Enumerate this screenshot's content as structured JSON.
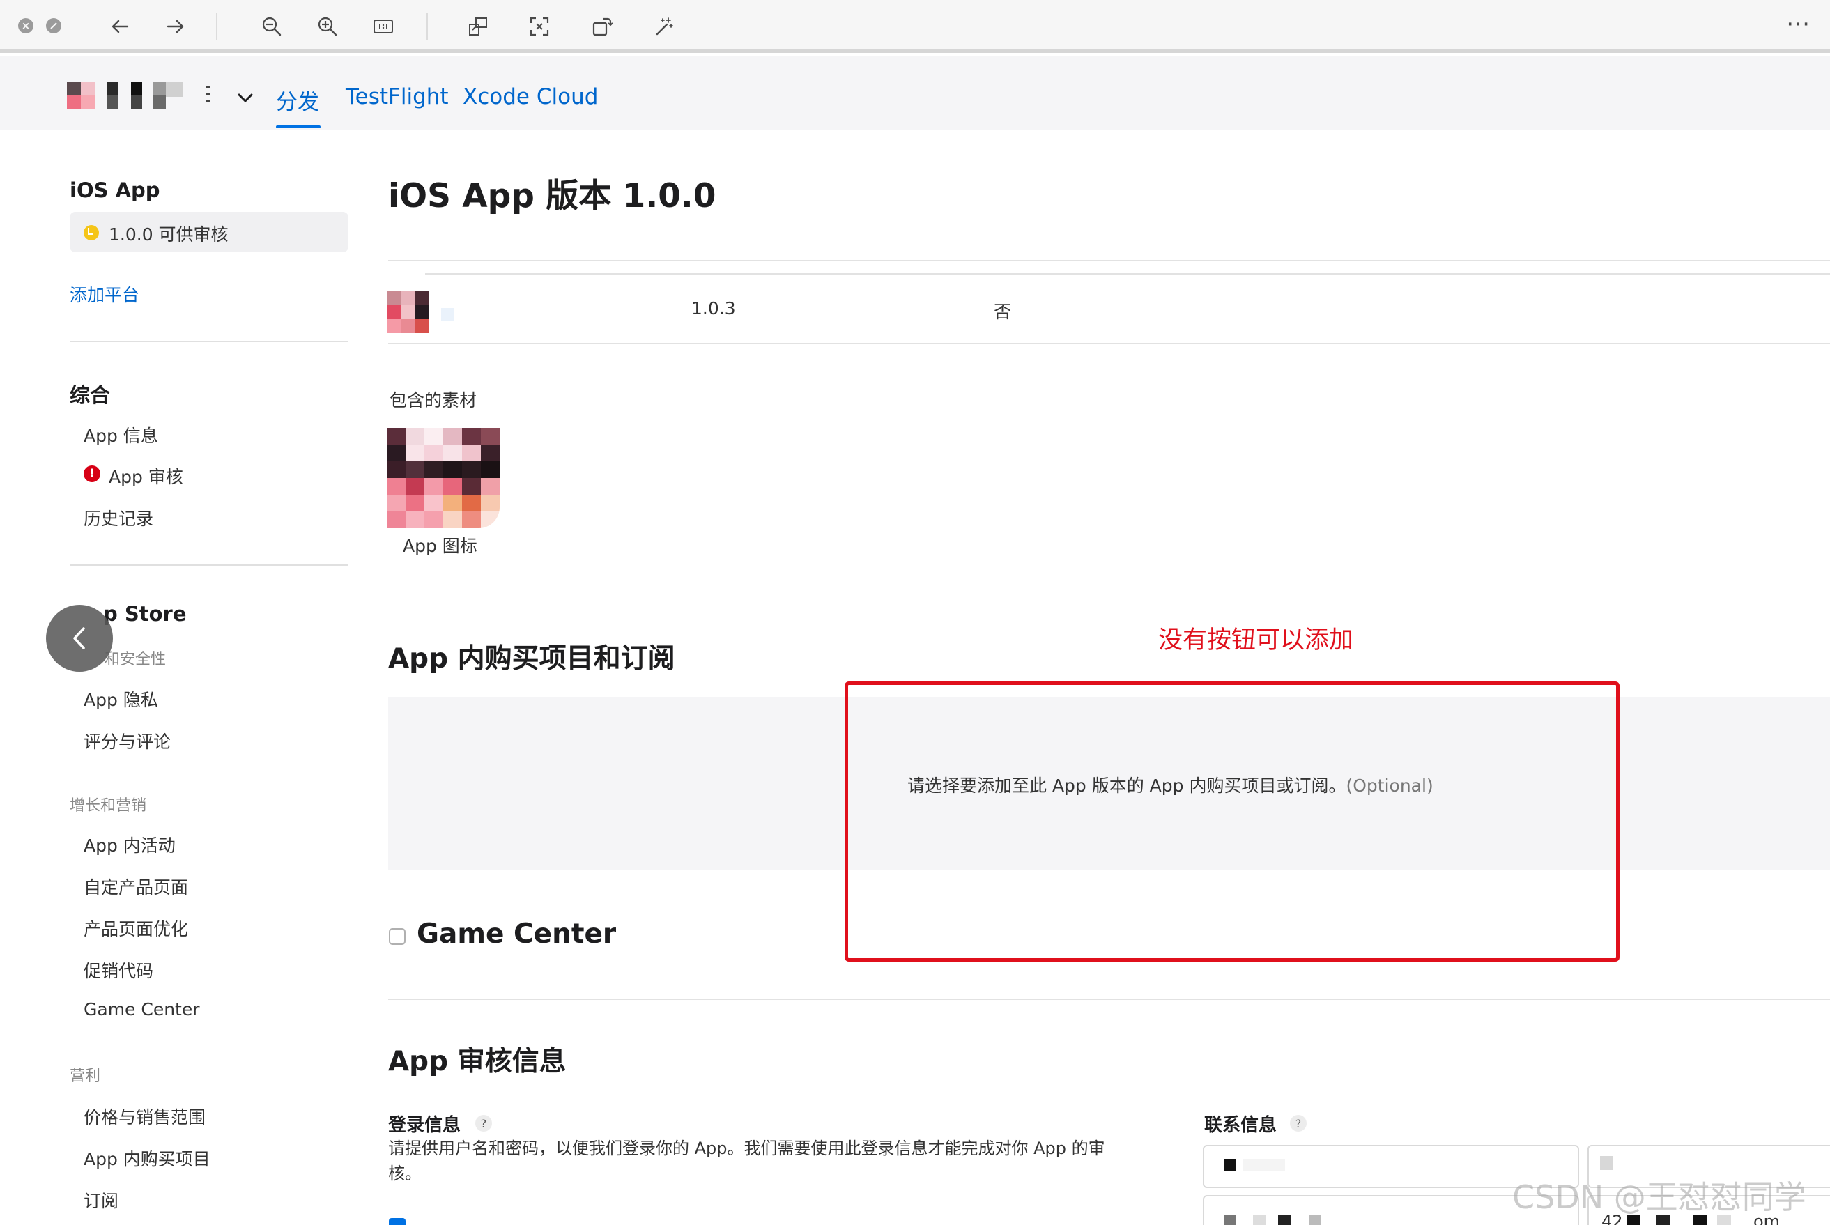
{
  "viewer": {
    "more_glyph": "⋯"
  },
  "header": {
    "tabs": [
      {
        "label": "分发"
      },
      {
        "label": "TestFlight"
      },
      {
        "label": "Xcode Cloud"
      }
    ]
  },
  "sidebar": {
    "platform_title": "iOS App",
    "version_status": "1.0.0 可供审核",
    "add_platform": "添加平台",
    "general_title": "综合",
    "general_items": [
      "App 信息",
      "App 审核",
      "历史记录"
    ],
    "store_title_visible": "p Store",
    "store_subtitle_visible": "和安全性",
    "store_items": [
      "App 隐私",
      "评分与评论"
    ],
    "growth_section": "增长和营销",
    "growth_items": [
      "App 内活动",
      "自定产品页面",
      "产品页面优化",
      "促销代码",
      "Game Center"
    ],
    "monetization_section": "营利",
    "monetization_items": [
      "价格与销售范围",
      "App 内购买项目",
      "订阅"
    ]
  },
  "main": {
    "page_title": "iOS App 版本 1.0.0",
    "build": {
      "version": "1.0.3",
      "flag": "否"
    },
    "assets_label": "包含的素材",
    "app_icon_caption": "App 图标",
    "iap_title": "App 内购买项目和订阅",
    "iap_prompt": "请选择要添加至此 App 版本的 App 内购买项目或订阅。",
    "iap_optional": "(Optional)",
    "annotation": "没有按钮可以添加",
    "game_center_label": "Game Center",
    "review_title": "App 审核信息",
    "login_title": "登录信息",
    "login_desc": "请提供用户名和密码，以便我们登录你的 App。我们需要使用此登录信息才能完成对你 App 的审核。",
    "contact_title": "联系信息",
    "help_glyph": "?",
    "contact_field_partial": "42",
    "contact_field_partial2": "om"
  },
  "watermark": "CSDN @王怼怼同学",
  "colors": {
    "accent": "#0066cc",
    "annotation_red": "#e0101c",
    "warning_red": "#d70015",
    "status_yellow": "#f5c518"
  }
}
